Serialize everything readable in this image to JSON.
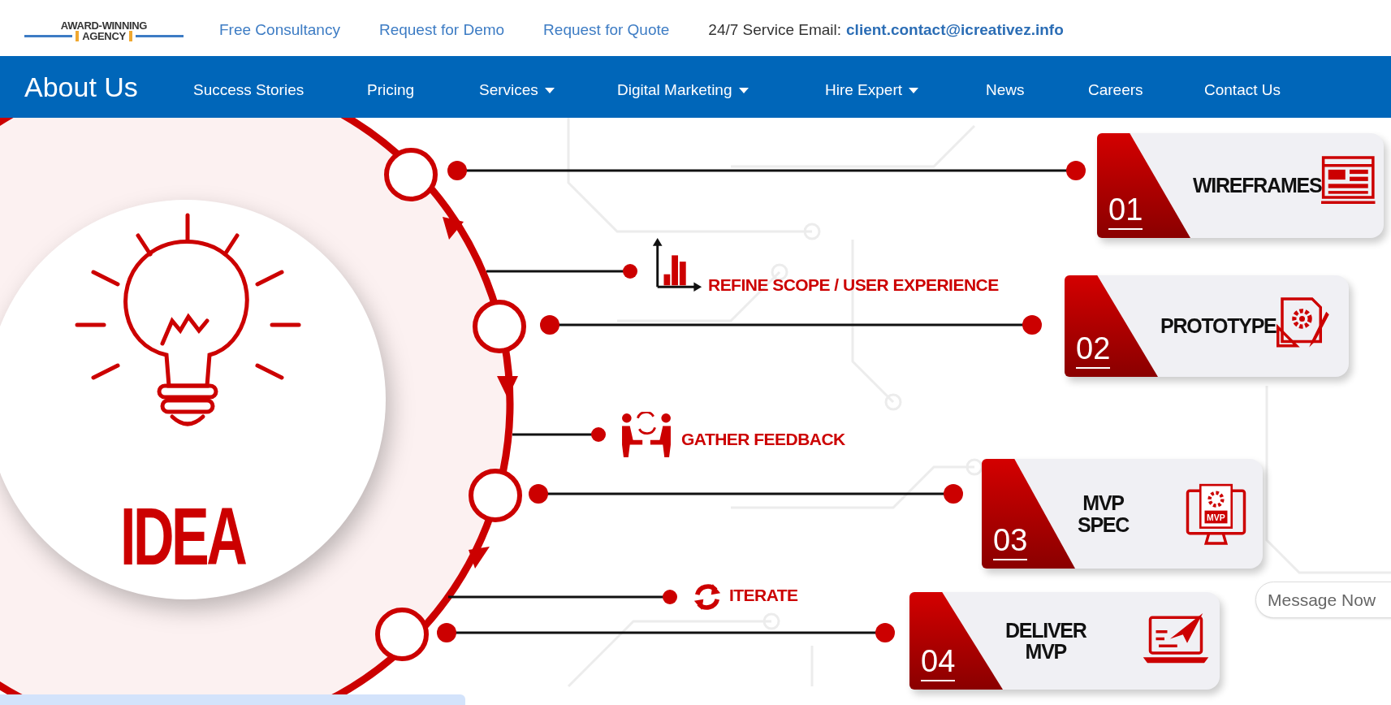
{
  "top_bar": {
    "logo": {
      "line_1": "AWARD-WINNING",
      "line_2": "AGENCY"
    },
    "links": [
      "Free Consultancy",
      "Request for Demo",
      "Request for Quote"
    ],
    "email_label": "24/7 Service Email:",
    "email": "client.contact@icreativez.info"
  },
  "nav": {
    "title": "About Us",
    "items": [
      {
        "label": "Success Stories",
        "dropdown": false
      },
      {
        "label": "Pricing",
        "dropdown": false
      },
      {
        "label": "Services",
        "dropdown": true
      },
      {
        "label": "Digital Marketing",
        "dropdown": true
      },
      {
        "label": "Hire Expert",
        "dropdown": true
      },
      {
        "label": "News",
        "dropdown": false
      },
      {
        "label": "Careers",
        "dropdown": false
      },
      {
        "label": "Contact Us",
        "dropdown": false
      }
    ]
  },
  "infographic": {
    "center_label": "IDEA",
    "steps": [
      {
        "number": "01",
        "title": "WIREFRAMES",
        "kind": "wireframe"
      },
      {
        "number": "02",
        "title": "PROTOTYPE",
        "kind": "prototype"
      },
      {
        "number": "03",
        "title": "MVP SPEC",
        "kind": "monitor",
        "icon_label": "MVP"
      },
      {
        "number": "04",
        "title": "DELIVER MVP",
        "kind": "laptop"
      }
    ],
    "notes": [
      {
        "text": "REFINE SCOPE / USER EXPERIENCE",
        "kind": "chart"
      },
      {
        "text": "GATHER FEEDBACK",
        "kind": "meeting"
      },
      {
        "text": "ITERATE",
        "kind": "cycle"
      }
    ]
  },
  "chat_button": "Message Now"
}
